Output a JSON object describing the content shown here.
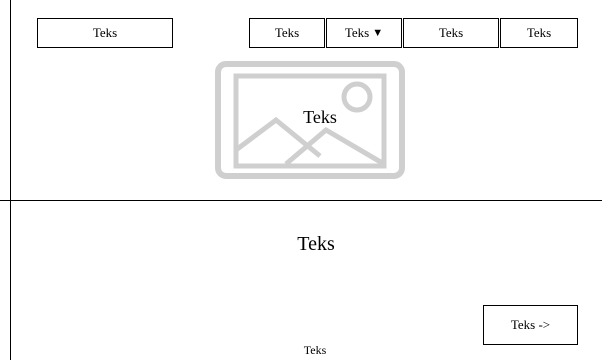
{
  "nav": {
    "logo_label": "Teks",
    "items": [
      {
        "label": "Teks"
      },
      {
        "label": "Teks",
        "dropdown": true
      },
      {
        "label": "Teks"
      },
      {
        "label": "Teks"
      }
    ]
  },
  "hero": {
    "image_icon": "image-placeholder-icon",
    "caption": "Teks"
  },
  "section": {
    "title": "Teks",
    "next_button_label": "Teks ->",
    "footer_text": "Teks"
  }
}
